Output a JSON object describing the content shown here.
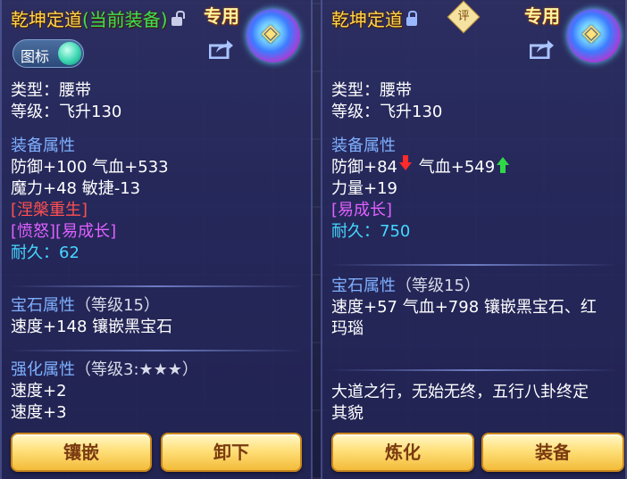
{
  "left_panel": {
    "title": "乾坤定道",
    "equipped_tag": "(当前装备)",
    "exclusive": "专用",
    "toggle_label": "图标",
    "type_line": "类型：腰带",
    "level_line": "等级：飞升130",
    "attr_header": "装备属性",
    "attr_line1": "防御+100 气血+533",
    "attr_line2": "魔力+48 敏捷-13",
    "special1": "[涅槃重生]",
    "special2": "[愤怒][易成长]",
    "durability_label": "耐久：",
    "durability_value": "62",
    "gem_header": "宝石属性",
    "gem_level": "（等级15）",
    "gem_line": "速度+148 镶嵌黑宝石",
    "enhance_header": "强化属性",
    "enhance_level": "（等级3:★★★）",
    "enhance_line1": "速度+2",
    "enhance_line2": "速度+3",
    "buttons": {
      "inlay": "镶嵌",
      "unequip": "卸下"
    }
  },
  "right_panel": {
    "title": "乾坤定道",
    "rate_badge": "评",
    "exclusive": "专用",
    "type_line": "类型：腰带",
    "level_line": "等级：飞升130",
    "attr_header": "装备属性",
    "defense": "防御+84",
    "hp": "气血+549",
    "strength": "力量+19",
    "special1": "[易成长]",
    "durability_label": "耐久：",
    "durability_value": "750",
    "gem_header": "宝石属性",
    "gem_level": "（等级15）",
    "gem_line1": "速度+57 气血+798 镶嵌黑宝石、红",
    "gem_line2": "玛瑙",
    "desc_line1": "大道之行，无始无终，五行八卦终定",
    "desc_line2": "其貌",
    "buttons": {
      "refine": "炼化",
      "equip": "装备"
    }
  },
  "colors": {
    "title_gold": "#ffd54d",
    "equipped_green": "#37e05a",
    "section_blue": "#7fb0ff",
    "special_red": "#ff5050",
    "special_pink": "#e060ff",
    "durability_cyan": "#44d8ff",
    "arrow_down_red": "#ff2a2a",
    "arrow_up_green": "#30d848"
  },
  "icons": [
    "lock-open-icon",
    "lock-icon",
    "share-icon",
    "emblem-icon",
    "rate-badge-icon",
    "stat-down-arrow-icon",
    "stat-up-arrow-icon"
  ]
}
